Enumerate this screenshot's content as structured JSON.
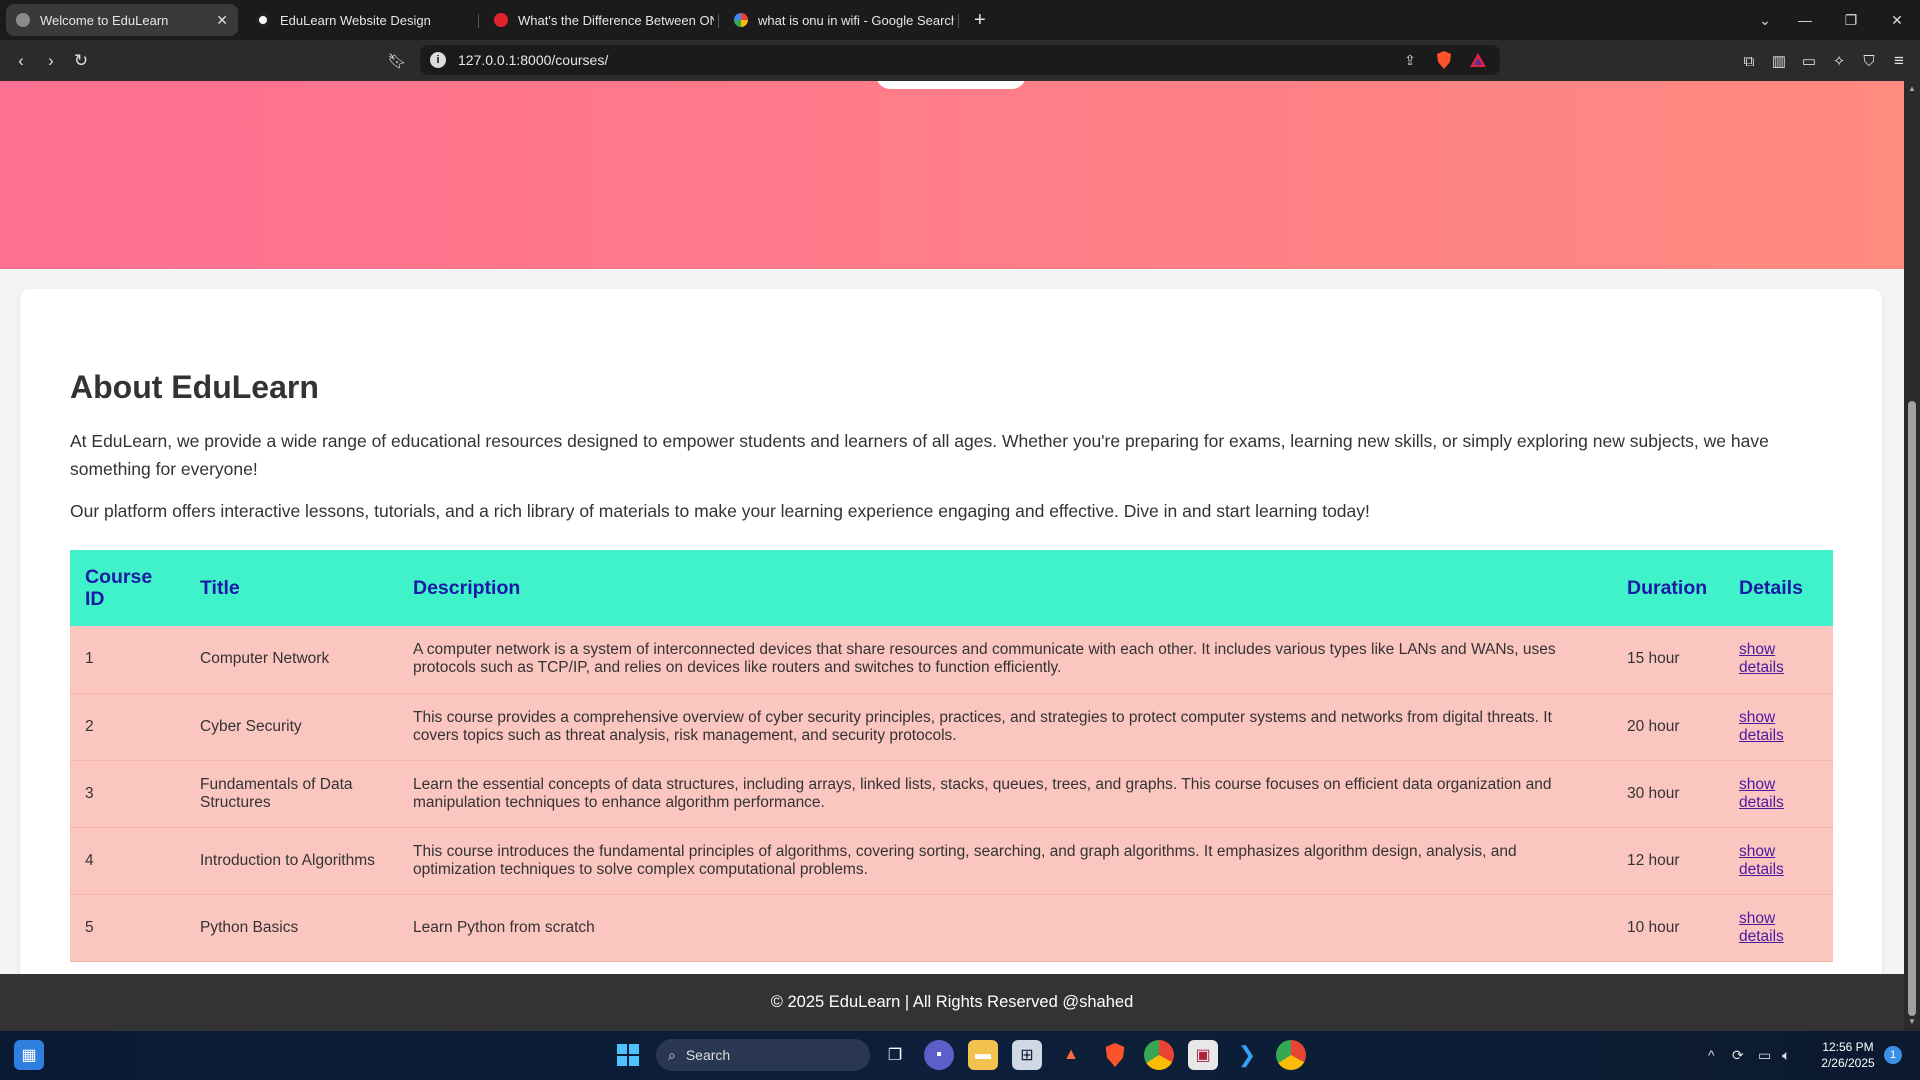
{
  "browser": {
    "tabs": [
      {
        "title": "Welcome to EduLearn",
        "active": true
      },
      {
        "title": "EduLearn Website Design",
        "active": false
      },
      {
        "title": "What's the Difference Between ONU",
        "active": false
      },
      {
        "title": "what is onu in wifi - Google Search",
        "active": false
      }
    ],
    "url": "127.0.0.1:8000/courses/"
  },
  "page": {
    "about_title": "About EduLearn",
    "about_paragraphs": [
      "At EduLearn, we provide a wide range of educational resources designed to empower students and learners of all ages. Whether you're preparing for exams, learning new skills, or simply exploring new subjects, we have something for everyone!",
      "Our platform offers interactive lessons, tutorials, and a rich library of materials to make your learning experience engaging and effective. Dive in and start learning today!"
    ],
    "table": {
      "headers": [
        "Course ID",
        "Title",
        "Description",
        "Duration",
        "Details"
      ],
      "rows": [
        {
          "id": "1",
          "title": "Computer Network",
          "description": "A computer network is a system of interconnected devices that share resources and communicate with each other. It includes various types like LANs and WANs, uses protocols such as TCP/IP, and relies on devices like routers and switches to function efficiently.",
          "duration": "15 hour",
          "details": "show details"
        },
        {
          "id": "2",
          "title": "Cyber Security",
          "description": "This course provides a comprehensive overview of cyber security principles, practices, and strategies to protect computer systems and networks from digital threats. It covers topics such as threat analysis, risk management, and security protocols.",
          "duration": "20 hour",
          "details": "show details"
        },
        {
          "id": "3",
          "title": "Fundamentals of Data Structures",
          "description": "Learn the essential concepts of data structures, including arrays, linked lists, stacks, queues, trees, and graphs. This course focuses on efficient data organization and manipulation techniques to enhance algorithm performance.",
          "duration": "30 hour",
          "details": "show details"
        },
        {
          "id": "4",
          "title": "Introduction to Algorithms",
          "description": "This course introduces the fundamental principles of algorithms, covering sorting, searching, and graph algorithms. It emphasizes algorithm design, analysis, and optimization techniques to solve complex computational problems.",
          "duration": "12 hour",
          "details": "show details"
        },
        {
          "id": "5",
          "title": "Python Basics",
          "description": "Learn Python from scratch",
          "duration": "10 hour",
          "details": "show details"
        }
      ]
    },
    "footer": "© 2025 EduLearn | All Rights Reserved @shahed"
  },
  "taskbar": {
    "search_label": "Search",
    "time": "12:56 PM",
    "date": "2/26/2025",
    "notification_count": "1"
  },
  "colors": {
    "hero_start": "#ff6f91",
    "hero_end": "#ff8a80",
    "table_header_bg": "#40f2c9",
    "table_header_text": "#1a1aa6",
    "table_row_bg": "#fcc6c0",
    "footer_bg": "#333333"
  }
}
